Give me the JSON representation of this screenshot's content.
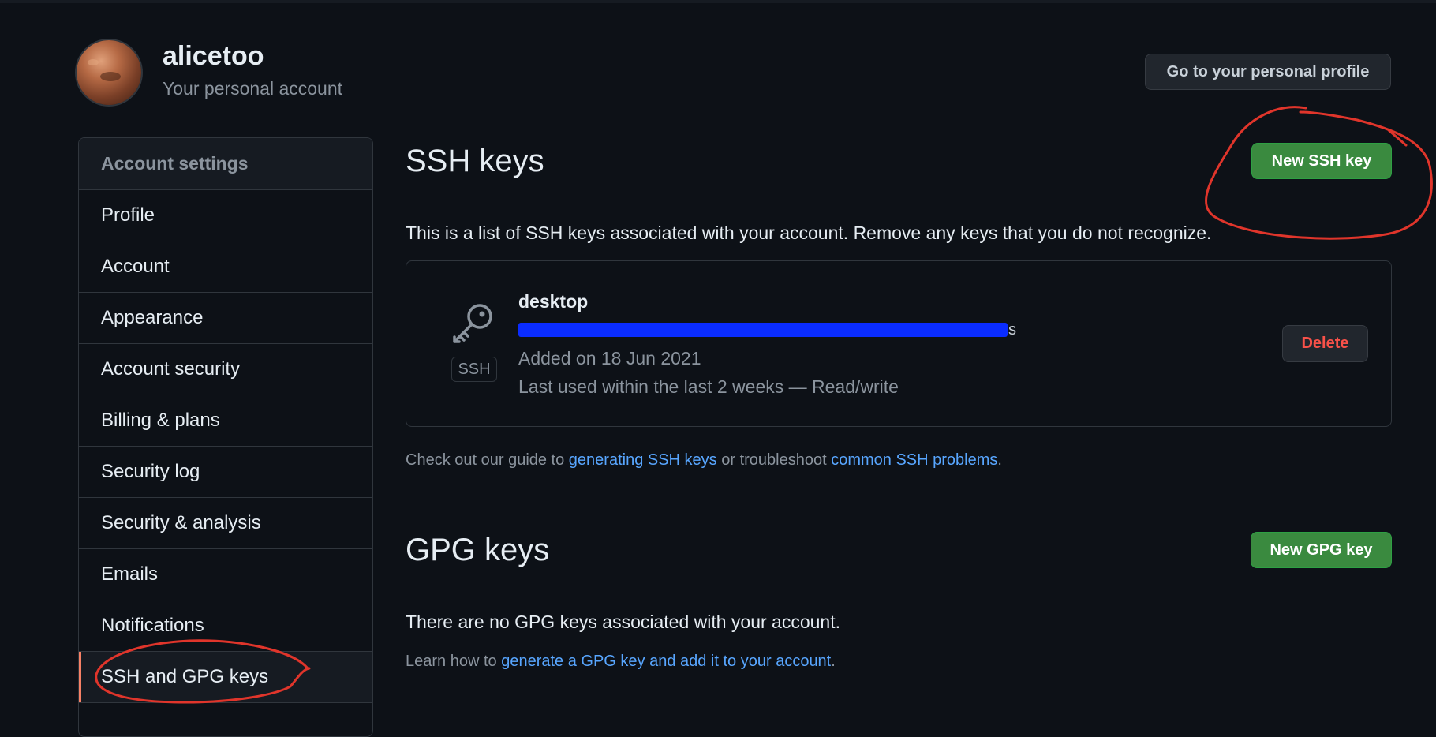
{
  "header": {
    "username": "alicetoo",
    "subtitle": "Your personal account",
    "profile_button": "Go to your personal profile"
  },
  "sidebar": {
    "heading": "Account settings",
    "items": [
      {
        "label": "Profile"
      },
      {
        "label": "Account"
      },
      {
        "label": "Appearance"
      },
      {
        "label": "Account security"
      },
      {
        "label": "Billing & plans"
      },
      {
        "label": "Security log"
      },
      {
        "label": "Security & analysis"
      },
      {
        "label": "Emails"
      },
      {
        "label": "Notifications"
      },
      {
        "label": "SSH and GPG keys",
        "active": true
      }
    ]
  },
  "ssh": {
    "title": "SSH keys",
    "new_button": "New SSH key",
    "description": "This is a list of SSH keys associated with your account. Remove any keys that you do not recognize.",
    "keys": [
      {
        "badge": "SSH",
        "name": "desktop",
        "fingerprint_tail": "s",
        "added": "Added on 18 Jun 2021",
        "last_used": "Last used within the last 2 weeks — Read/write",
        "delete_label": "Delete"
      }
    ],
    "guide_prefix": "Check out our guide to ",
    "guide_link1": "generating SSH keys",
    "guide_middle": " or troubleshoot ",
    "guide_link2": "common SSH problems",
    "guide_suffix": "."
  },
  "gpg": {
    "title": "GPG keys",
    "new_button": "New GPG key",
    "empty_text": "There are no GPG keys associated with your account.",
    "learn_prefix": "Learn how to ",
    "learn_link": "generate a GPG key and add it to your account",
    "learn_suffix": "."
  },
  "colors": {
    "background": "#0d1117",
    "accent_green": "#3a8a3f",
    "link": "#58a6ff",
    "danger": "#f85149",
    "annotation_red": "#e0352b",
    "redaction_blue": "#0a2cff"
  },
  "icons": {
    "key": "key-icon"
  }
}
